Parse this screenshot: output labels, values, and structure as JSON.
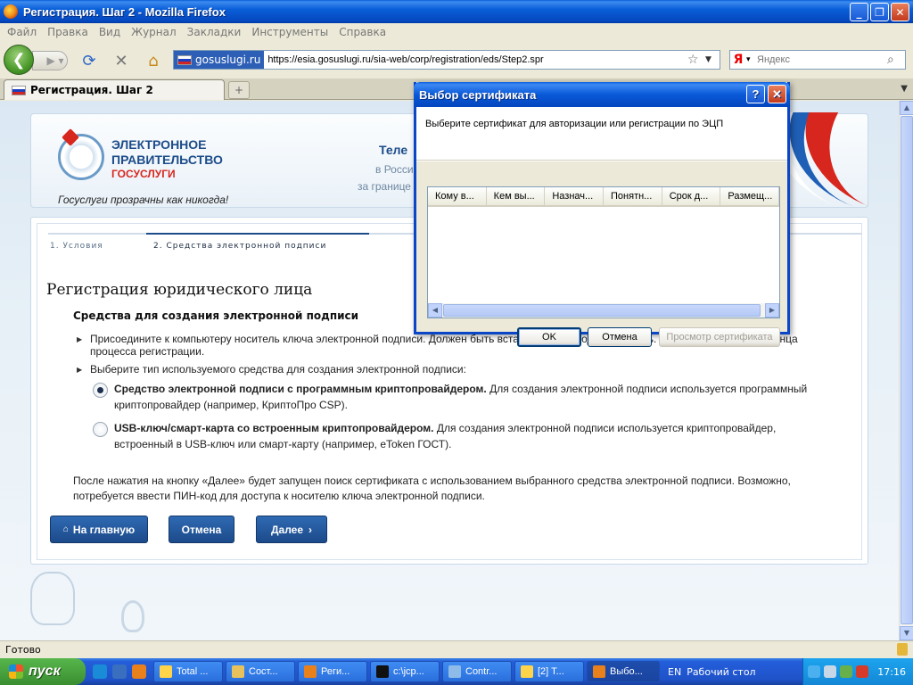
{
  "window": {
    "title": "Регистрация. Шаг 2 - Mozilla Firefox",
    "min_label": "_",
    "max_label": "❐",
    "close_label": "✕"
  },
  "menu": [
    "Файл",
    "Правка",
    "Вид",
    "Журнал",
    "Закладки",
    "Инструменты",
    "Справка"
  ],
  "nav": {
    "site_label": "gosuslugi.ru",
    "url": "https://esia.gosuslugi.ru/sia-web/corp/registration/eds/Step2.spr",
    "search_placeholder": "Яндекс",
    "search_engine_letter": "Я"
  },
  "tab": {
    "title": "Регистрация. Шаг 2",
    "close": "✕",
    "new_tab": "+"
  },
  "header": {
    "logo_line1": "ЭЛЕКТРОННОЕ",
    "logo_line2": "ПРАВИТЕЛЬСТВО",
    "logo_line3": "ГОСУСЛУГИ",
    "slogan": "Госуслуги прозрачны как никогда!",
    "phone_title": "Теле",
    "in_russia": "в Росси",
    "abroad": "за границе"
  },
  "steps": {
    "step1": "1. Условия",
    "step2": "2. Средства электронной подписи"
  },
  "main": {
    "heading": "Регистрация юридического лица",
    "subheading": "Средства для создания электронной подписи",
    "bullet1": "Присоедините к компьютеру носитель ключа электронной подписи. Должен быть вставлен только один носитель. Не извлекайте его до конца процесса регистрации.",
    "bullet2": "Выберите тип используемого средства для создания электронной подписи:",
    "radio1_bold": "Средство электронной подписи с программным криптопровайдером.",
    "radio1_text": " Для создания электронной подписи используется программный криптопровайдер (например, КриптоПро CSP).",
    "radio2_bold": "USB-ключ/смарт-карта со встроенным криптопровайдером.",
    "radio2_text": " Для создания электронной подписи используется криптопровайдер, встроенный в USB-ключ или смарт-карту (например, eToken ГОСТ).",
    "notice": "После нажатия на кнопку «Далее» будет запущен поиск сертификата с использованием выбранного средства электронной подписи. Возможно, потребуется ввести ПИН-код для доступа к носителю ключа электронной подписи.",
    "btn_home": "На главную",
    "btn_cancel": "Отмена",
    "btn_next": "Далее",
    "selected_radio": 1
  },
  "dialog": {
    "title": "Выбор сертификата",
    "help": "?",
    "close": "✕",
    "prompt": "Выберите сертификат для авторизации или регистрации по ЭЦП",
    "columns": [
      "Кому в...",
      "Кем вы...",
      "Назнач...",
      "Понятн...",
      "Срок д...",
      "Размещ..."
    ],
    "rows": [],
    "ok": "OK",
    "cancel": "Отмена",
    "view_cert": "Просмотр сертификата"
  },
  "status": {
    "text": "Готово"
  },
  "taskbar": {
    "start": "пуск",
    "tasks": [
      "Total ...",
      "Сост...",
      "Реги...",
      "c:\\jcp...",
      "Contr...",
      "[2] T...",
      "Выбо..."
    ],
    "active_task": 6,
    "lang": "EN",
    "desktop": "Рабочий стол",
    "time": "17:16"
  }
}
